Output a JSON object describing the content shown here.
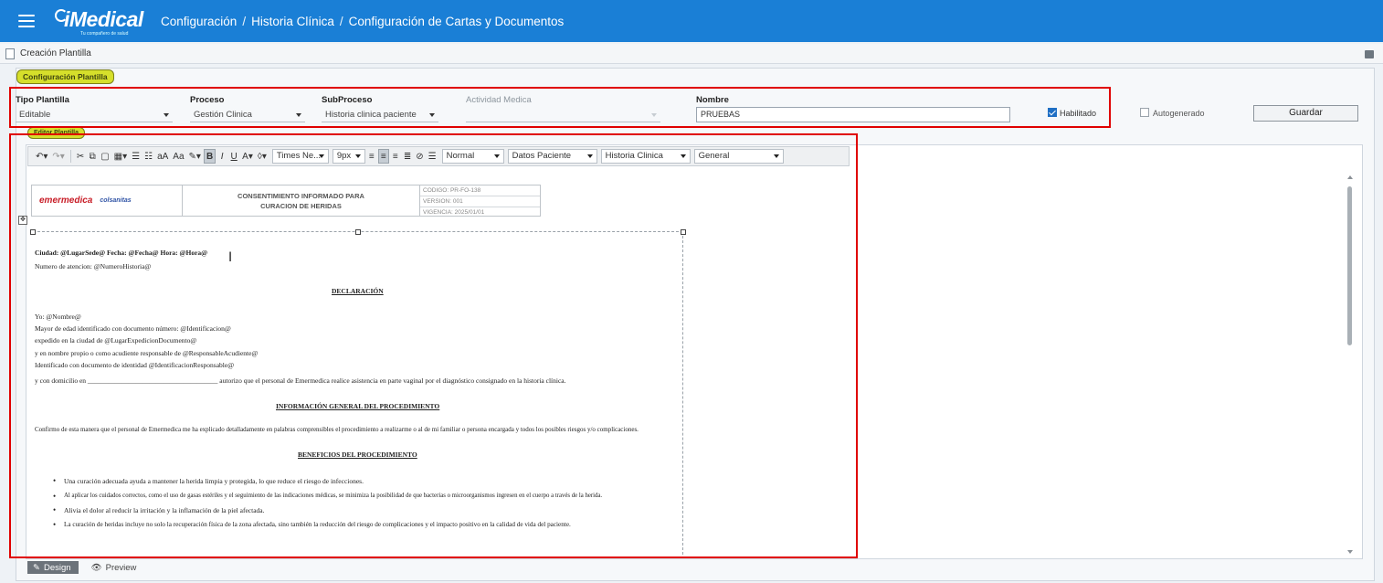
{
  "topbar": {
    "app_name": "iMedical",
    "tagline": "Tu compañero de salud",
    "breadcrumb": [
      "Configuración",
      "Historia Clínica",
      "Configuración de Cartas y Documentos"
    ],
    "color": "#1a7fd6"
  },
  "window": {
    "title": "Creación Plantilla"
  },
  "config": {
    "section_label": "Configuración Plantilla",
    "tipo_label": "Tipo Plantilla",
    "tipo_value": "Editable",
    "proceso_label": "Proceso",
    "proceso_value": "Gestión Clinica",
    "subproceso_label": "SubProceso",
    "subproceso_value": "Historia clinica paciente",
    "actividad_label": "Actividad Medica",
    "actividad_value": "",
    "nombre_label": "Nombre",
    "nombre_value": "PRUEBAS",
    "habilitado_label": "Habilitado",
    "habilitado_checked": true,
    "autogenerado_label": "Autogenerado",
    "autogenerado_checked": false,
    "save_label": "Guardar"
  },
  "editor": {
    "section_label": "Editor Plantilla",
    "toolbar": {
      "font_name": "Times Ne...",
      "font_size": "9px",
      "format": "Normal",
      "datos_paciente": "Datos Paciente",
      "historia_clinica": "Historia Clinica",
      "general": "General"
    },
    "doc_header": {
      "brand": "emermedica",
      "brand2": "colsanitas",
      "title_line1": "CONSENTIMIENTO INFORMADO PARA",
      "title_line2": "CURACION DE HERIDAS",
      "codigo": "CODIGO: PR-FO-138",
      "version": "VERSION: 001",
      "vigencia": "VIGENCIA: 2025/01/01"
    },
    "doc_lines": {
      "ciudad": "Ciudad: @LugarSede@ Fecha: @Fecha@  Hora: @Hora@",
      "numero": "Numero de atencion: @NumeroHistoria@",
      "declaracion": "DECLARACIÓN",
      "yo": "Yo: @Nombre@",
      "mayor": "Mayor de edad identificado con documento número: @Identificacion@",
      "expedido": "expedido en la ciudad de @LugarExpedicionDocumento@",
      "nombre_propio": "y en nombre propio o como acudiente responsable de @ResponsableAcudiente@",
      "identificado": "Identificado con documento de identidad @IdentificacionResponsable@",
      "domicilio": "y con domicilio en ______________________________________ autorizo que el personal de Emermedica realice asistencia en parte vaginal por el diagnóstico consignado en la historia clínica.",
      "info_general": "INFORMACIÓN GENERAL DEL PROCEDIMIENTO",
      "confirmo": "Confirmo de esta manera que el personal de Emermedica me ha explicado detalladamente en palabras comprensibles el procedimiento a realizarme o al de mi familiar o persona encargada y todos los posibles riesgos y/o complicaciones.",
      "beneficios": "BENEFICIOS DEL PROCEDIMIENTO"
    },
    "bullets": [
      "Una curación adecuada ayuda a mantener la herida limpia y protegida, lo que reduce el riesgo de infecciones.",
      "Al aplicar los cuidados correctos, como el uso de gasas estériles y el seguimiento de las indicaciones médicas, se minimiza la posibilidad de que bacterias o microorganismos ingresen en el cuerpo a través de la herida.",
      "Alivia el dolor al reducir la irritación y la inflamación de la piel afectada.",
      "La curación de heridas incluye no solo la recuperación física de la zona afectada, sino también la reducción del riesgo de complicaciones y el impacto positivo en la calidad de vida del paciente."
    ],
    "tabs": {
      "design": "Design",
      "preview": "Preview"
    }
  },
  "icons": [
    "menu-icon",
    "doc-icon",
    "pencil-icon",
    "eye-icon"
  ],
  "colors": {
    "highlight_red": "#e00000",
    "tag_yellow": "#d6df2b"
  }
}
